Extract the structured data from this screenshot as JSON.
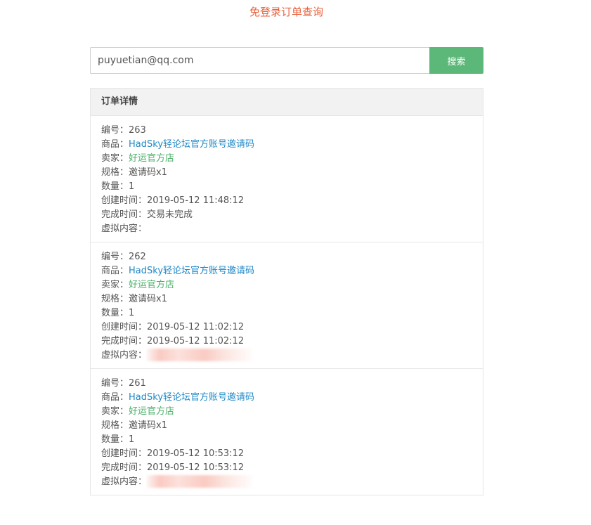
{
  "page": {
    "title": "免登录订单查询"
  },
  "search": {
    "value": "puyuetian@qq.com",
    "button_label": "搜索"
  },
  "panel": {
    "header": "订单详情"
  },
  "labels": {
    "id": "编号：",
    "product": "商品：",
    "seller": "卖家：",
    "spec": "规格：",
    "quantity": "数量：",
    "created": "创建时间：",
    "completed": "完成时间：",
    "virtual_content": "虚拟内容："
  },
  "orders": [
    {
      "id": "263",
      "product": "HadSky轻论坛官方账号邀请码",
      "seller": "好运官方店",
      "spec": "邀请码x1",
      "quantity": "1",
      "created": "2019-05-12 11:48:12",
      "completed": "交易未完成",
      "virtual_content_redacted": false
    },
    {
      "id": "262",
      "product": "HadSky轻论坛官方账号邀请码",
      "seller": "好运官方店",
      "spec": "邀请码x1",
      "quantity": "1",
      "created": "2019-05-12 11:02:12",
      "completed": "2019-05-12 11:02:12",
      "virtual_content_redacted": true
    },
    {
      "id": "261",
      "product": "HadSky轻论坛官方账号邀请码",
      "seller": "好运官方店",
      "spec": "邀请码x1",
      "quantity": "1",
      "created": "2019-05-12 10:53:12",
      "completed": "2019-05-12 10:53:12",
      "virtual_content_redacted": true
    }
  ],
  "colors": {
    "title": "#e8603c",
    "button": "#5cb878",
    "link": "#1e88c7",
    "seller": "#4caf6a"
  }
}
